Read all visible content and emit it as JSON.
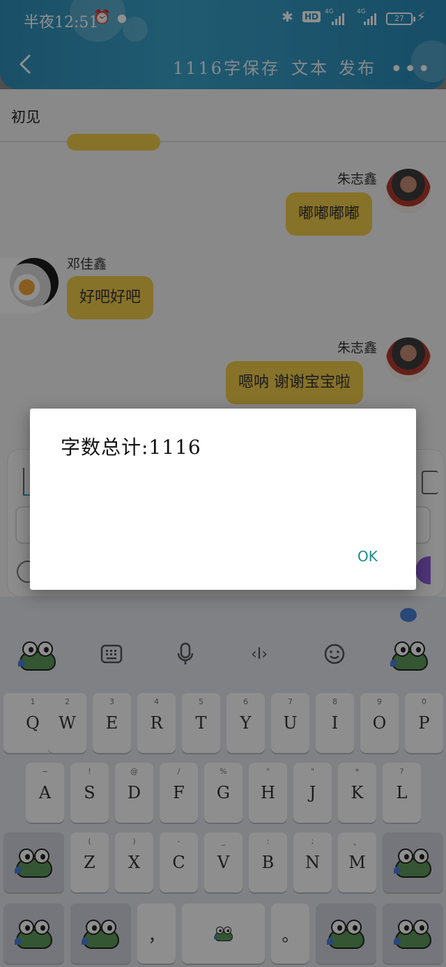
{
  "status_bar": {
    "time": "半夜12:51",
    "battery": "27",
    "network": "4G",
    "hd_label": "HD"
  },
  "nav": {
    "word_count": "1116字",
    "save": "保存",
    "text": "文本",
    "publish": "发布",
    "more": "•••"
  },
  "chat": {
    "title": "初见",
    "messages": [
      {
        "sender": "朱志鑫",
        "text": "嘟嘟嘟嘟",
        "side": "right"
      },
      {
        "sender": "邓佳鑫",
        "text": "好吧好吧",
        "side": "left"
      },
      {
        "sender": "朱志鑫",
        "text": "嗯呐 谢谢宝宝啦",
        "side": "right"
      }
    ]
  },
  "dialog": {
    "message": "字数总计:1116",
    "ok_label": "OK"
  },
  "keyboard": {
    "row1": [
      {
        "key": "Q",
        "hint": "1"
      },
      {
        "key": "W",
        "hint": "2"
      },
      {
        "key": "E",
        "hint": "3"
      },
      {
        "key": "R",
        "hint": "4"
      },
      {
        "key": "T",
        "hint": "5"
      },
      {
        "key": "Y",
        "hint": "6"
      },
      {
        "key": "U",
        "hint": "7"
      },
      {
        "key": "I",
        "hint": "8"
      },
      {
        "key": "O",
        "hint": "9"
      },
      {
        "key": "P",
        "hint": "0"
      }
    ],
    "row2": [
      {
        "key": "A",
        "hint": "~"
      },
      {
        "key": "S",
        "hint": "!"
      },
      {
        "key": "D",
        "hint": "@"
      },
      {
        "key": "F",
        "hint": "/"
      },
      {
        "key": "G",
        "hint": "%"
      },
      {
        "key": "H",
        "hint": "\""
      },
      {
        "key": "J",
        "hint": "\""
      },
      {
        "key": "K",
        "hint": "*"
      },
      {
        "key": "L",
        "hint": "?"
      }
    ],
    "row3": [
      {
        "key": "Z",
        "hint": "("
      },
      {
        "key": "X",
        "hint": ")"
      },
      {
        "key": "C",
        "hint": "-"
      },
      {
        "key": "V",
        "hint": "_"
      },
      {
        "key": "B",
        "hint": ":"
      },
      {
        "key": "N",
        "hint": ";"
      },
      {
        "key": "M",
        "hint": "、"
      }
    ],
    "comma": "，",
    "period": "。",
    "toolbar_icons": [
      "frog-icon",
      "keyboard-icon",
      "microphone-icon",
      "cursor-icon",
      "emoji-icon",
      "frog-icon"
    ]
  },
  "colors": {
    "header": "#3aa2c9",
    "bubble": "#f1cb4a",
    "dialog_button": "#1f8a8a",
    "send_button": "#8e5bd8"
  }
}
